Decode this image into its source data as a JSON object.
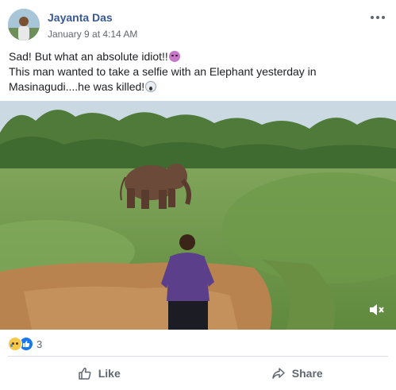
{
  "post": {
    "author": "Jayanta Das",
    "timestamp": "January 9 at 4:14 AM",
    "text_line1": "Sad! But what an absolute idiot!!",
    "text_line2": "This man wanted to take a selfie with an Elephant yesterday in",
    "text_line3": "Masinagudi....he was killed!",
    "emoji1": "angry-face-emoji",
    "emoji2": "screaming-face-emoji"
  },
  "media": {
    "type": "video",
    "content": "man standing on dirt path facing an elephant in a grassy field",
    "control": "mute-icon"
  },
  "reactions": {
    "icons": [
      "sad-reaction",
      "like-reaction"
    ],
    "count": "3"
  },
  "actions": {
    "like_label": "Like",
    "share_label": "Share"
  },
  "colors": {
    "author_link": "#385898",
    "secondary_text": "#616770",
    "like_blue": "#1877f2",
    "divider": "#dadde1"
  }
}
